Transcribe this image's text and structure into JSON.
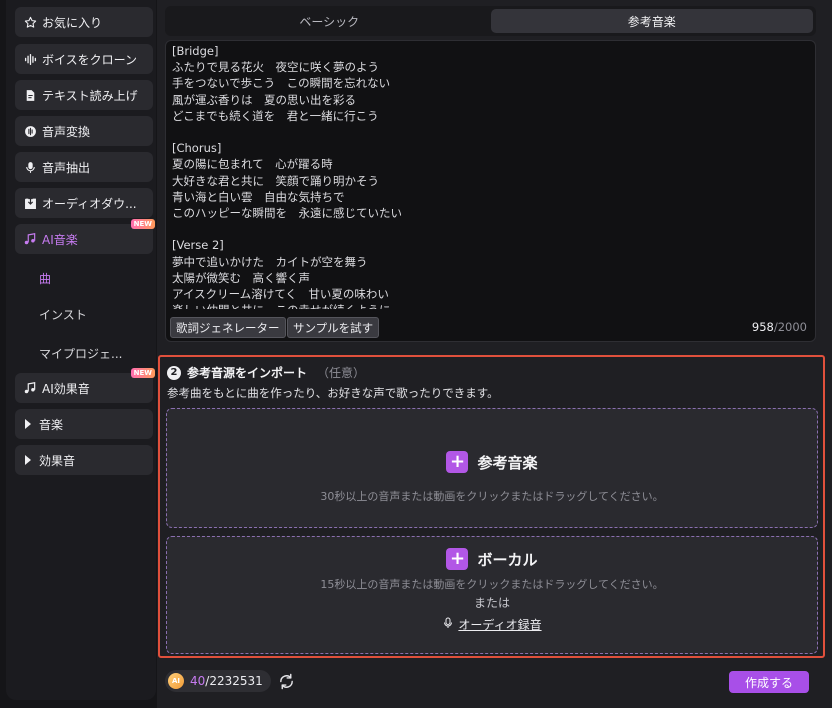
{
  "sidebar": {
    "items": [
      {
        "label": "お気に入り",
        "icon": "star-icon"
      },
      {
        "label": "ボイスをクローン",
        "icon": "waveform-icon"
      },
      {
        "label": "テキスト読み上げ",
        "icon": "document-icon"
      },
      {
        "label": "音声変換",
        "icon": "voice-change-icon"
      },
      {
        "label": "音声抽出",
        "icon": "microphone-icon"
      },
      {
        "label": "オーディオダウ...",
        "icon": "download-icon"
      },
      {
        "label": "AI音楽",
        "icon": "music-note-icon",
        "badge": "NEW"
      },
      {
        "label": "AI効果音",
        "icon": "music-note-icon",
        "badge": "NEW"
      },
      {
        "label": "音楽",
        "icon": "caret-right-icon"
      },
      {
        "label": "効果音",
        "icon": "caret-right-icon"
      }
    ],
    "sub_items": [
      "曲",
      "インスト",
      "マイプロジェ..."
    ]
  },
  "tabs": [
    "ベーシック",
    "参考音楽"
  ],
  "lyrics": {
    "text": "[Bridge]\nふたりで見る花火　夜空に咲く夢のよう\n手をつないで歩こう　この瞬間を忘れない\n風が運ぶ香りは　夏の思い出を彩る\nどこまでも続く道を　君と一緒に行こう\n\n[Chorus]\n夏の陽に包まれて　心が躍る時\n大好きな君と共に　笑顔で踊り明かそう\n青い海と白い雲　自由な気持ちで\nこのハッピーな瞬間を　永遠に感じていたい\n\n[Verse 2]\n夢中で追いかけた　カイトが空を舞う\n太陽が微笑む　高く響く声\nアイスクリーム溶けてく　甘い夏の味わい\n楽しい仲間と共に　この幸せが続くように",
    "generator_button": "歌詞ジェネレーター",
    "sample_button": "サンプルを試す",
    "count": "958",
    "max": "/2000"
  },
  "import": {
    "step": "2",
    "title": "参考音源をインポート",
    "optional": "（任意）",
    "description": "参考曲をもとに曲を作ったり、お好きな声で歌ったりできます。",
    "reference": {
      "title": "参考音楽",
      "hint": "30秒以上の音声または動画をクリックまたはドラッグしてください。"
    },
    "vocal": {
      "title": "ボーカル",
      "hint": "15秒以上の音声または動画をクリックまたはドラッグしてください。",
      "or": "または",
      "record": "オーディオ録音"
    }
  },
  "footer": {
    "coin_label": "AI",
    "credits_used": "40",
    "credits_total": "/2232531",
    "create_button": "作成する"
  },
  "colors": {
    "accent": "#a84fe8",
    "highlight_border": "#e0503c"
  }
}
